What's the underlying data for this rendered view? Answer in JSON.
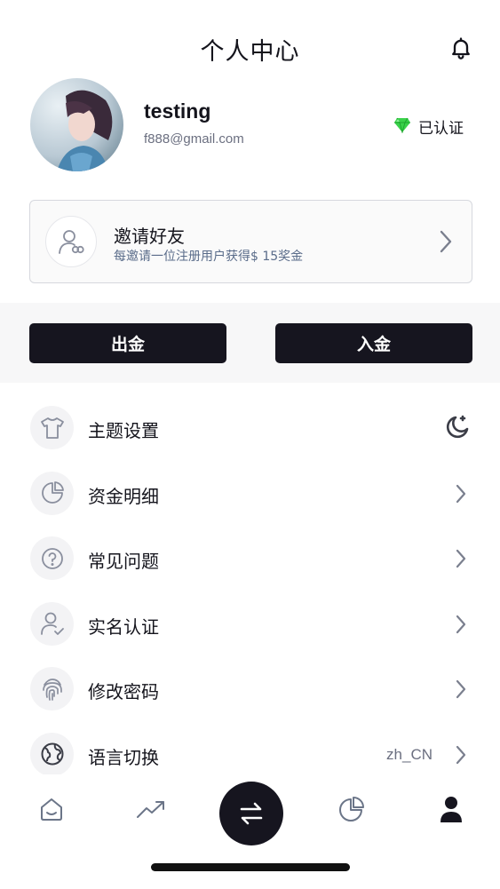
{
  "header": {
    "title": "个人中心",
    "notification_icon": "bell-icon"
  },
  "profile": {
    "username": "testing",
    "email": "f888@gmail.com",
    "verified_label": "已认证",
    "verified_icon": "diamond-icon"
  },
  "invite": {
    "title": "邀请好友",
    "subtitle": "每邀请一位注册用户获得$ 15奖金"
  },
  "funds": {
    "withdraw_label": "出金",
    "deposit_label": "入金"
  },
  "menu": {
    "items": [
      {
        "label": "主题设置",
        "icon": "shirt-icon"
      },
      {
        "label": "资金明细",
        "icon": "pie-chart-icon"
      },
      {
        "label": "常见问题",
        "icon": "question-icon"
      },
      {
        "label": "实名认证",
        "icon": "user-check-icon"
      },
      {
        "label": "修改密码",
        "icon": "fingerprint-icon"
      },
      {
        "label": "语言切换",
        "icon": "globe-icon",
        "value": "zh_CN"
      }
    ]
  },
  "tabbar": {
    "items": [
      "home-icon",
      "trending-icon",
      "swap-icon",
      "pie-chart-icon",
      "user-icon"
    ],
    "active": "user-icon"
  },
  "colors": {
    "primary": "#16151f",
    "muted": "#6b6f80",
    "accent_green": "#2ecc40"
  }
}
